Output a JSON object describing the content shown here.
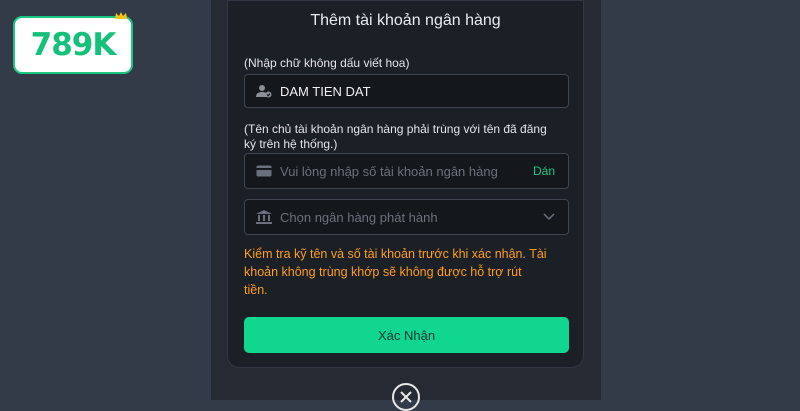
{
  "brand": {
    "logo_text": "789K",
    "color": "#19c781"
  },
  "modal": {
    "title": "Thêm tài khoản ngân hàng",
    "name_hint": "(Nhập chữ không dấu viết hoa)",
    "name_value": "DAM TIEN DAT",
    "name_icon": "user-check-icon",
    "account_hint_line1": "(Tên chủ tài khoản ngân hàng phải trùng với tên đã đăng",
    "account_hint_line2": "ký trên hệ thống.)",
    "account_placeholder": "Vui lòng nhập số tài khoản ngân hàng",
    "account_icon": "card-icon",
    "paste_label": "Dán",
    "bank_placeholder": "Chọn ngân hàng phát hành",
    "bank_icon": "bank-icon",
    "warning_line1": "Kiểm tra kỹ tên và số tài khoản trước khi xác nhận. Tài",
    "warning_line2": "khoản không trùng khớp sẽ không được hỗ trợ rút",
    "warning_line3": "tiền.",
    "confirm_label": "Xác Nhận",
    "close_icon": "close-circle-icon"
  },
  "colors": {
    "accent": "#11d68f",
    "warning": "#ff9f1a",
    "modal_bg": "#1b1f26",
    "page_bg": "#333a48"
  }
}
